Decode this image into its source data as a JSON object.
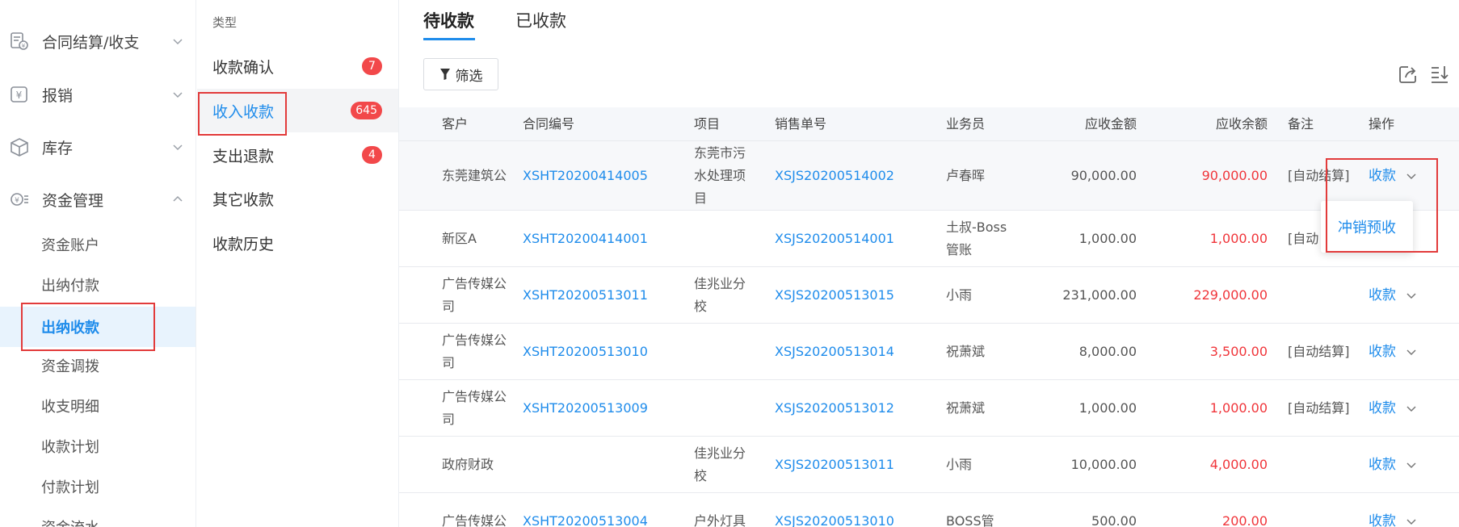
{
  "nav": {
    "groups": [
      {
        "label": "合同结算/收支",
        "icon": "contract-settlement-icon"
      },
      {
        "label": "报销",
        "icon": "reimbursement-icon"
      },
      {
        "label": "库存",
        "icon": "inventory-box-icon"
      },
      {
        "label": "资金管理",
        "icon": "fund-management-icon"
      }
    ],
    "fund_items": [
      "资金账户",
      "出纳付款",
      "出纳收款",
      "资金调拨",
      "收支明细",
      "收款计划",
      "付款计划",
      "资金流水"
    ],
    "active_item": "出纳收款"
  },
  "types": {
    "header": "类型",
    "items": [
      {
        "label": "收款确认",
        "badge": "7"
      },
      {
        "label": "收入收款",
        "badge": "645"
      },
      {
        "label": "支出退款",
        "badge": "4"
      },
      {
        "label": "其它收款",
        "badge": ""
      },
      {
        "label": "收款历史",
        "badge": ""
      }
    ],
    "active": "收入收款"
  },
  "tabs": [
    "待收款",
    "已收款"
  ],
  "active_tab": "待收款",
  "toolbar": {
    "filter_label": "筛选",
    "export_icon": "export-icon",
    "sort_icon": "sort-download-icon"
  },
  "table": {
    "headers": {
      "customer": "客户",
      "contract": "合同编号",
      "project": "项目",
      "sales_no": "销售单号",
      "salesman": "业务员",
      "receivable": "应收金额",
      "balance": "应收余额",
      "note": "备注",
      "action": "操作"
    },
    "rows": [
      {
        "customer": "东莞建筑公",
        "contract": "XSHT20200414005",
        "project": "东莞市污水处理项目",
        "sales_no": "XSJS20200514002",
        "salesman": "卢春晖",
        "receivable": "90,000.00",
        "balance": "90,000.00",
        "note": "[自动结算]",
        "action": "收款"
      },
      {
        "customer": "新区A",
        "contract": "XSHT20200414001",
        "project": "",
        "sales_no": "XSJS20200514001",
        "salesman": "土叔-Boss管账",
        "receivable": "1,000.00",
        "balance": "1,000.00",
        "note": "[自动",
        "action": ""
      },
      {
        "customer": "广告传媒公司",
        "contract": "XSHT20200513011",
        "project": "佳兆业分校",
        "sales_no": "XSJS20200513015",
        "salesman": "小雨",
        "receivable": "231,000.00",
        "balance": "229,000.00",
        "note": "",
        "action": "收款"
      },
      {
        "customer": "广告传媒公司",
        "contract": "XSHT20200513010",
        "project": "",
        "sales_no": "XSJS20200513014",
        "salesman": "祝萧斌",
        "receivable": "8,000.00",
        "balance": "3,500.00",
        "note": "[自动结算]",
        "action": "收款"
      },
      {
        "customer": "广告传媒公司",
        "contract": "XSHT20200513009",
        "project": "",
        "sales_no": "XSJS20200513012",
        "salesman": "祝萧斌",
        "receivable": "1,000.00",
        "balance": "1,000.00",
        "note": "[自动结算]",
        "action": "收款"
      },
      {
        "customer": "政府财政",
        "contract": "",
        "project": "佳兆业分校",
        "sales_no": "XSJS20200513011",
        "salesman": "小雨",
        "receivable": "10,000.00",
        "balance": "4,000.00",
        "note": "",
        "action": "收款"
      },
      {
        "customer": "广告传媒公",
        "contract": "XSHT20200513004",
        "project": "户外灯具",
        "sales_no": "XSJS20200513010",
        "salesman": "BOSS管",
        "receivable": "500.00",
        "balance": "200.00",
        "note": "",
        "action": "收款"
      }
    ]
  },
  "dropdown": {
    "item": "冲销预收"
  },
  "colors": {
    "accent": "#1f8ceb",
    "badge": "#f2484a",
    "negative": "#f0353a",
    "highlight": "#e23b3b"
  }
}
